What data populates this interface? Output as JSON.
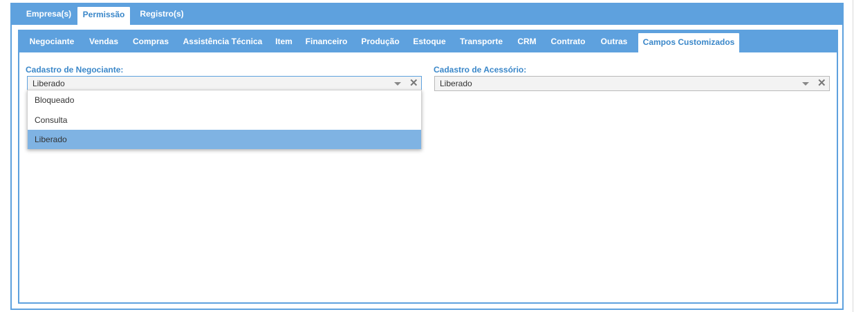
{
  "outer_tabs": [
    {
      "label": "Empresa(s)"
    },
    {
      "label": "Permissão",
      "active": true
    },
    {
      "label": "Registro(s)"
    }
  ],
  "inner_tabs": [
    {
      "label": "Negociante"
    },
    {
      "label": "Vendas"
    },
    {
      "label": "Compras"
    },
    {
      "label": "Assistência Técnica"
    },
    {
      "label": "Item"
    },
    {
      "label": "Financeiro"
    },
    {
      "label": "Produção"
    },
    {
      "label": "Estoque"
    },
    {
      "label": "Transporte"
    },
    {
      "label": "CRM"
    },
    {
      "label": "Contrato"
    },
    {
      "label": "Outras"
    },
    {
      "label": "Campos Customizados",
      "active": true
    }
  ],
  "fields": {
    "negociante": {
      "label": "Cadastro de Negociante:",
      "value": "Liberado",
      "open": true
    },
    "acessorio": {
      "label": "Cadastro de Acessório:",
      "value": "Liberado"
    }
  },
  "dropdown_options": [
    {
      "label": "Bloqueado"
    },
    {
      "label": "Consulta"
    },
    {
      "label": "Liberado",
      "selected": true
    }
  ],
  "icons": {
    "caret": "chevron-down-icon",
    "clear": "close-icon"
  },
  "clear_glyph": "✕",
  "colors": {
    "accent": "#5ea1de",
    "active_tab_text": "#3a87c9",
    "selected_option": "#7fb3e3"
  }
}
